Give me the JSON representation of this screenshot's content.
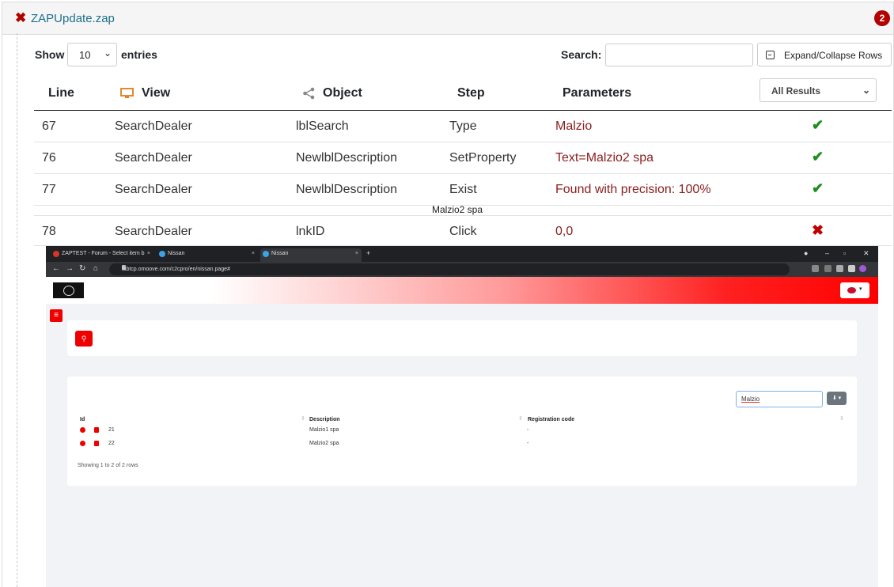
{
  "header": {
    "title": "ZAPUpdate.zap",
    "badge": "2",
    "status_icon": "close-icon"
  },
  "controls": {
    "show_label": "Show",
    "entries_value": "10",
    "entries_label": "entries",
    "search_label": "Search:",
    "search_value": "",
    "expand_label": "Expand/Collapse Rows",
    "results_filter": "All Results"
  },
  "columns": {
    "line": "Line",
    "view": "View",
    "object": "Object",
    "step": "Step",
    "parameters": "Parameters"
  },
  "rows": [
    {
      "line": "67",
      "view": "SearchDealer",
      "object": "lblSearch",
      "step": "Type",
      "parameters": "Malzio",
      "status": "✔"
    },
    {
      "line": "76",
      "view": "SearchDealer",
      "object": "NewlblDescription",
      "step": "SetProperty",
      "parameters": "Text=Malzio2 spa",
      "status": "✔"
    },
    {
      "line": "77",
      "view": "SearchDealer",
      "object": "NewlblDescription",
      "step": "Exist",
      "parameters": "Found with precision: 100%",
      "status": "✔"
    },
    {
      "line": "78",
      "view": "SearchDealer",
      "object": "lnkID",
      "step": "Click",
      "parameters": "0,0",
      "status": "✖"
    }
  ],
  "row77_note": "Malzio2 spa",
  "colors": {
    "accent_red": "#b30000",
    "success": "#1e8c1e",
    "param_text": "#8b2020"
  },
  "screenshot": {
    "tabs": [
      {
        "title": "ZAPTEST - Forum - Select item b",
        "close": "×"
      },
      {
        "title": "Nissan",
        "close": "×"
      },
      {
        "title": "Nissan",
        "close": "×"
      }
    ],
    "new_tab": "+",
    "url": "labtcp.omoove.com/c2cpro/en/nissan.page#",
    "search_value": "Malzio",
    "table_headers": {
      "id": "Id",
      "description": "Description",
      "registration": "Registration code"
    },
    "table_rows": [
      {
        "id": "21",
        "description": "Malzio1 spa",
        "registration": "-"
      },
      {
        "id": "22",
        "description": "Malzio2 spa",
        "registration": "-"
      }
    ],
    "footer": "Showing 1 to 2 of 2 rows"
  }
}
